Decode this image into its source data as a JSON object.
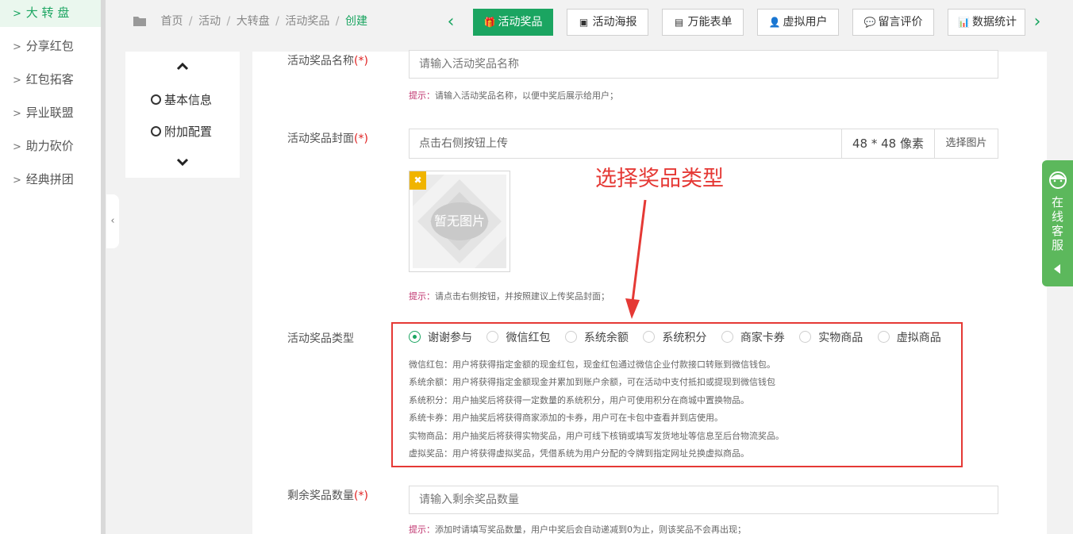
{
  "sidebar": {
    "items": [
      {
        "label": "大 转 盘",
        "active": true
      },
      {
        "label": "分享红包"
      },
      {
        "label": "红包拓客"
      },
      {
        "label": "异业联盟"
      },
      {
        "label": "助力砍价"
      },
      {
        "label": "经典拼团"
      }
    ],
    "chevron": ">",
    "collapse_glyph": "‹"
  },
  "breadcrumb": {
    "folder_icon": "folder-icon",
    "items": [
      "首页",
      "活动",
      "大转盘",
      "活动奖品"
    ],
    "separator": "/",
    "current": "创建"
  },
  "tabs": {
    "prev_glyph": "‹",
    "next_glyph": "›",
    "items": [
      {
        "label": "活动奖品",
        "icon": "gift-icon",
        "glyph": "🎁",
        "active": true
      },
      {
        "label": "活动海报",
        "icon": "image-icon",
        "glyph": "▣"
      },
      {
        "label": "万能表单",
        "icon": "form-icon",
        "glyph": "▤"
      },
      {
        "label": "虚拟用户",
        "icon": "user-add-icon",
        "glyph": "👤"
      },
      {
        "label": "留言评价",
        "icon": "comment-icon",
        "glyph": "💬"
      },
      {
        "label": "数据统计",
        "icon": "bar-chart-icon",
        "glyph": "📊"
      }
    ]
  },
  "anchor_panel": {
    "items": [
      "基本信息",
      "附加配置"
    ]
  },
  "form": {
    "prize_name": {
      "label": "活动奖品名称",
      "required": "(*)",
      "placeholder": "请输入活动奖品名称",
      "hint_key": "提示：",
      "hint": "请输入活动奖品名称，以便中奖后展示给用户；"
    },
    "prize_cover": {
      "label": "活动奖品封面",
      "required": "(*)",
      "placeholder": "点击右侧按钮上传",
      "size": "48 * 48 像素",
      "button": "选择图片",
      "thumb_text": "暂无图片",
      "delete_glyph": "✖",
      "hint_key": "提示：",
      "hint": "请点击右侧按钮，并按照建议上传奖品封面；"
    },
    "prize_type": {
      "label": "活动奖品类型",
      "options": [
        "谢谢参与",
        "微信红包",
        "系统余额",
        "系统积分",
        "商家卡券",
        "实物商品",
        "虚拟商品"
      ],
      "selected": "谢谢参与",
      "descriptions": [
        "微信红包：用户将获得指定金额的现金红包，现金红包通过微信企业付款接口转账到微信钱包。",
        "系统余额：用户将获得指定金额现金并累加到账户余额，可在活动中支付抵扣或提现到微信钱包",
        "系统积分：用户抽奖后将获得一定数量的系统积分，用户可使用积分在商城中置换物品。",
        "系统卡券：用户抽奖后将获得商家添加的卡券，用户可在卡包中查看并到店使用。",
        "实物商品：用户抽奖后将获得实物奖品，用户可线下核销或填写发货地址等信息至后台物流奖品。",
        "虚拟奖品：用户将获得虚拟奖品，凭借系统为用户分配的令牌到指定网址兑换虚拟商品。"
      ]
    },
    "remaining_qty": {
      "label": "剩余奖品数量",
      "required": "(*)",
      "placeholder": "请输入剩余奖品数量",
      "hint_key": "提示：",
      "hint": "添加时请填写奖品数量，用户中奖后会自动递减到0为止，则该奖品不会再出现；"
    }
  },
  "annotation": {
    "text": "选择奖品类型",
    "color": "#e53935"
  },
  "service": {
    "label": "在线客服"
  },
  "colors": {
    "accent": "#1ba561",
    "service": "#5cb85c",
    "hint_key": "#c0336e",
    "required": "#e02020"
  }
}
